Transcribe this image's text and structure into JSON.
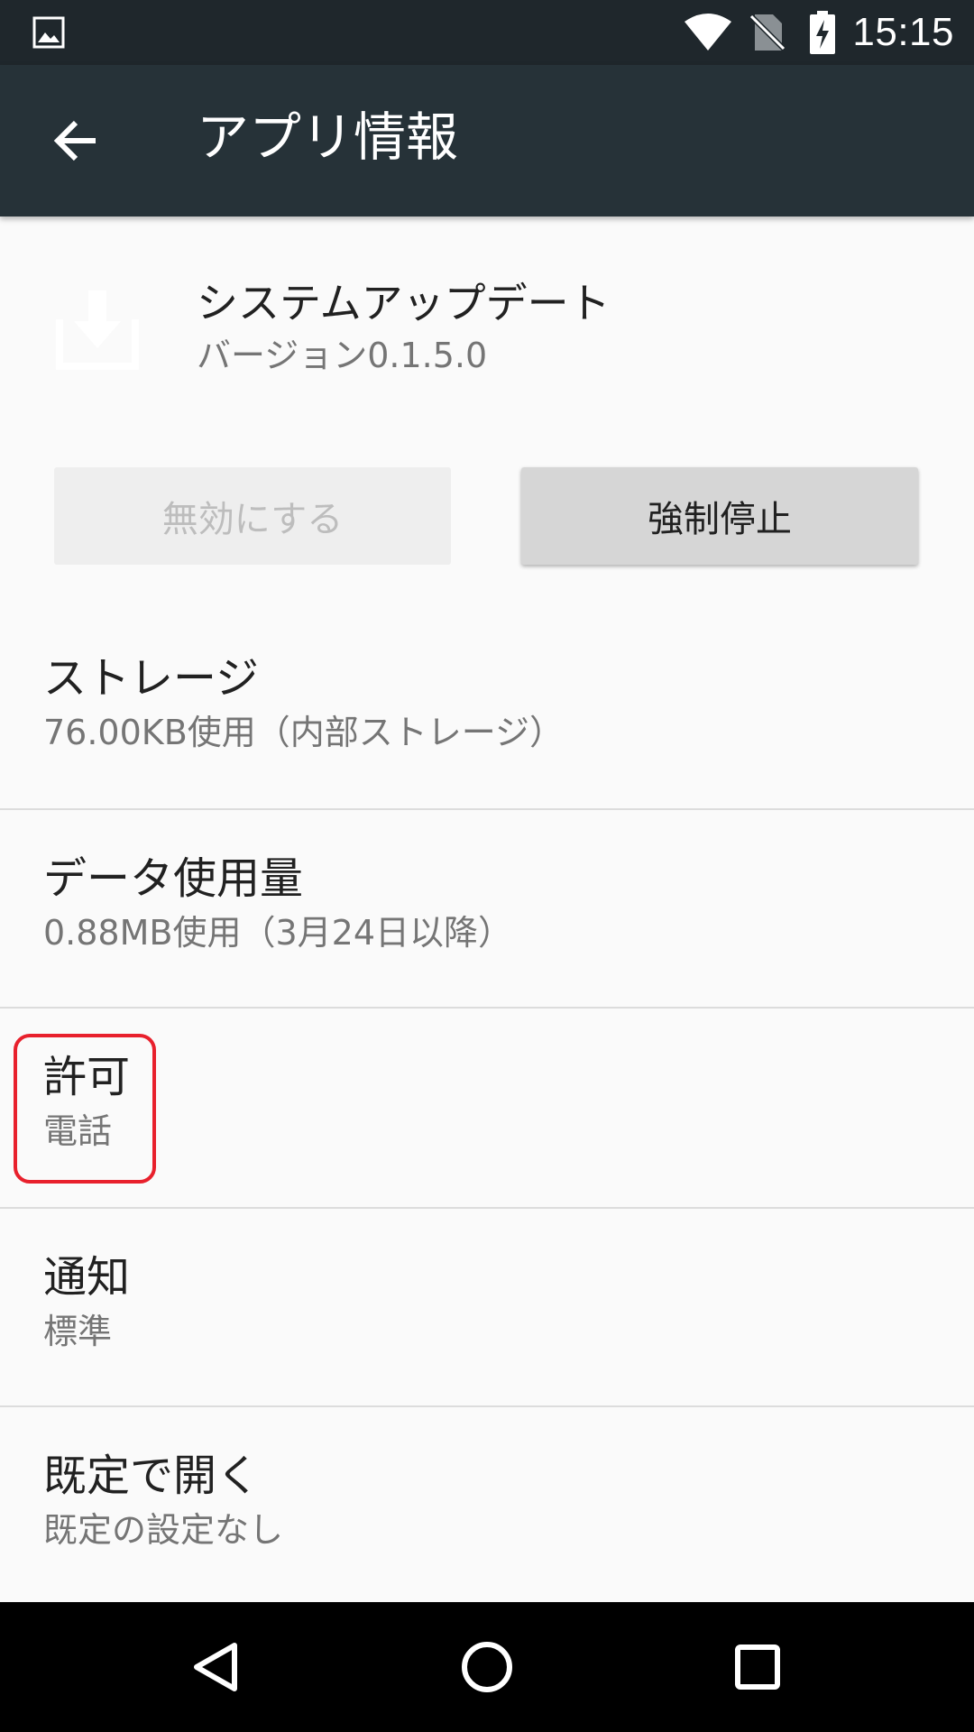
{
  "status_bar": {
    "time": "15:15",
    "icons": [
      "image-notification-icon",
      "wifi-icon",
      "no-sim-icon",
      "battery-charging-icon"
    ]
  },
  "toolbar": {
    "title": "アプリ情報",
    "back_icon": "arrow-back-icon"
  },
  "app": {
    "name": "システムアップデート",
    "version": "バージョン0.1.5.0",
    "icon": "download-icon"
  },
  "buttons": {
    "disable_label": "無効にする",
    "force_stop_label": "強制停止"
  },
  "settings": [
    {
      "title": "ストレージ",
      "summary": "76.00KB使用（内部ストレージ）"
    },
    {
      "title": "データ使用量",
      "summary": "0.88MB使用（3月24日以降）"
    },
    {
      "title": "許可",
      "summary": "電話"
    },
    {
      "title": "通知",
      "summary": "標準"
    },
    {
      "title": "既定で開く",
      "summary": "既定の設定なし"
    }
  ],
  "nav_bar": {
    "icons": [
      "back-triangle-icon",
      "home-circle-icon",
      "recents-square-icon"
    ]
  },
  "colors": {
    "status_bar": "#1f272c",
    "toolbar": "#263238",
    "background": "#fafafa",
    "highlight": "#e8202c"
  }
}
